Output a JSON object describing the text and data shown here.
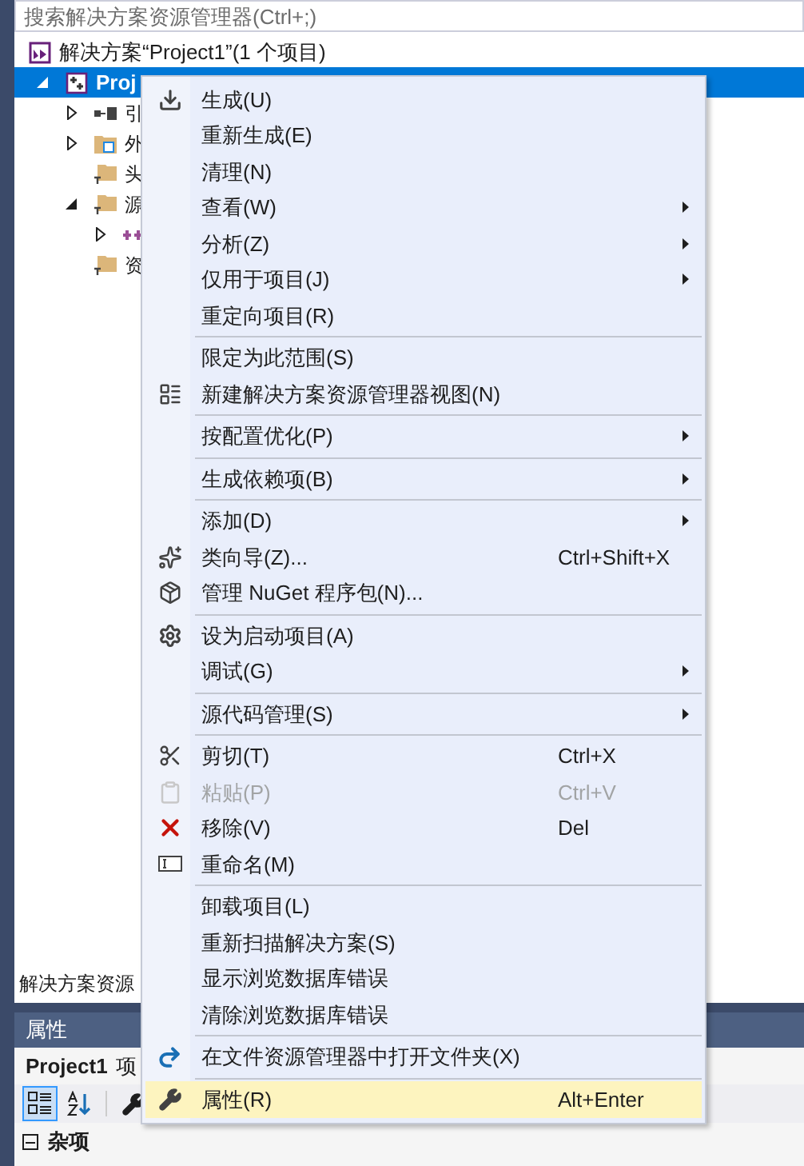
{
  "search": {
    "placeholder": "搜索解决方案资源管理器(Ctrl+;)"
  },
  "tree": [
    {
      "kind": "solution",
      "label": "解决方案“Project1”(1 个项目)",
      "selected": false,
      "children": [
        {
          "kind": "project",
          "label": "Proj",
          "selected": true,
          "expanded": true,
          "children": [
            {
              "kind": "references",
              "label": "引",
              "selected": false,
              "expanded": false
            },
            {
              "kind": "external",
              "label": "外",
              "selected": false,
              "expanded": false
            },
            {
              "kind": "folder",
              "label": "头",
              "selected": false
            },
            {
              "kind": "folder",
              "label": "源",
              "selected": false,
              "expanded": true,
              "children": [
                {
                  "kind": "file",
                  "selected": false,
                  "expanded": false
                }
              ]
            },
            {
              "kind": "folder",
              "label": "资",
              "selected": false
            }
          ]
        }
      ]
    }
  ],
  "explorer_tab": "解决方案资源",
  "properties": {
    "title": "属性",
    "object_name": "Project1",
    "object_type": "项",
    "toolbar": [
      {
        "selected": true
      },
      {
        "selected": false
      },
      {
        "selected": false
      }
    ],
    "category": {
      "label": "杂项",
      "expanded": true
    }
  },
  "context_menu": [
    {
      "kind": "item",
      "label": "生成(U)",
      "submenu": false,
      "disabled": false,
      "selected": false
    },
    {
      "kind": "item",
      "label": "重新生成(E)",
      "submenu": false,
      "disabled": false,
      "selected": false
    },
    {
      "kind": "item",
      "label": "清理(N)",
      "submenu": false,
      "disabled": false,
      "selected": false
    },
    {
      "kind": "item",
      "label": "查看(W)",
      "submenu": true,
      "disabled": false,
      "selected": false
    },
    {
      "kind": "item",
      "label": "分析(Z)",
      "submenu": true,
      "disabled": false,
      "selected": false
    },
    {
      "kind": "item",
      "label": "仅用于项目(J)",
      "submenu": true,
      "disabled": false,
      "selected": false
    },
    {
      "kind": "item",
      "label": "重定向项目(R)",
      "submenu": false,
      "disabled": false,
      "selected": false
    },
    {
      "kind": "separator"
    },
    {
      "kind": "item",
      "label": "限定为此范围(S)",
      "submenu": false,
      "disabled": false,
      "selected": false
    },
    {
      "kind": "item",
      "label": "新建解决方案资源管理器视图(N)",
      "submenu": false,
      "disabled": false,
      "selected": false
    },
    {
      "kind": "separator"
    },
    {
      "kind": "item",
      "label": "按配置优化(P)",
      "submenu": true,
      "disabled": false,
      "selected": false
    },
    {
      "kind": "separator"
    },
    {
      "kind": "item",
      "label": "生成依赖项(B)",
      "submenu": true,
      "disabled": false,
      "selected": false
    },
    {
      "kind": "separator"
    },
    {
      "kind": "item",
      "label": "添加(D)",
      "submenu": true,
      "disabled": false,
      "selected": false
    },
    {
      "kind": "item",
      "label": "类向导(Z)...",
      "shortcut": "Ctrl+Shift+X",
      "submenu": false,
      "disabled": false,
      "selected": false
    },
    {
      "kind": "item",
      "label": "管理 NuGet 程序包(N)...",
      "submenu": false,
      "disabled": false,
      "selected": false
    },
    {
      "kind": "separator"
    },
    {
      "kind": "item",
      "label": "设为启动项目(A)",
      "submenu": false,
      "disabled": false,
      "selected": false
    },
    {
      "kind": "item",
      "label": "调试(G)",
      "submenu": true,
      "disabled": false,
      "selected": false
    },
    {
      "kind": "separator"
    },
    {
      "kind": "item",
      "label": "源代码管理(S)",
      "submenu": true,
      "disabled": false,
      "selected": false
    },
    {
      "kind": "separator"
    },
    {
      "kind": "item",
      "label": "剪切(T)",
      "shortcut": "Ctrl+X",
      "submenu": false,
      "disabled": false,
      "selected": false
    },
    {
      "kind": "item",
      "label": "粘贴(P)",
      "shortcut": "Ctrl+V",
      "submenu": false,
      "disabled": true,
      "selected": false
    },
    {
      "kind": "item",
      "label": "移除(V)",
      "shortcut": "Del",
      "submenu": false,
      "disabled": false,
      "selected": false
    },
    {
      "kind": "item",
      "label": "重命名(M)",
      "submenu": false,
      "disabled": false,
      "selected": false
    },
    {
      "kind": "separator"
    },
    {
      "kind": "item",
      "label": "卸载项目(L)",
      "submenu": false,
      "disabled": false,
      "selected": false
    },
    {
      "kind": "item",
      "label": "重新扫描解决方案(S)",
      "submenu": false,
      "disabled": false,
      "selected": false
    },
    {
      "kind": "item",
      "label": "显示浏览数据库错误",
      "submenu": false,
      "disabled": false,
      "selected": false
    },
    {
      "kind": "item",
      "label": "清除浏览数据库错误",
      "submenu": false,
      "disabled": false,
      "selected": false
    },
    {
      "kind": "separator"
    },
    {
      "kind": "item",
      "label": "在文件资源管理器中打开文件夹(X)",
      "submenu": false,
      "disabled": false,
      "selected": false
    },
    {
      "kind": "separator"
    },
    {
      "kind": "item",
      "label": "属性(R)",
      "shortcut": "Alt+Enter",
      "submenu": false,
      "disabled": false,
      "selected": true
    }
  ]
}
